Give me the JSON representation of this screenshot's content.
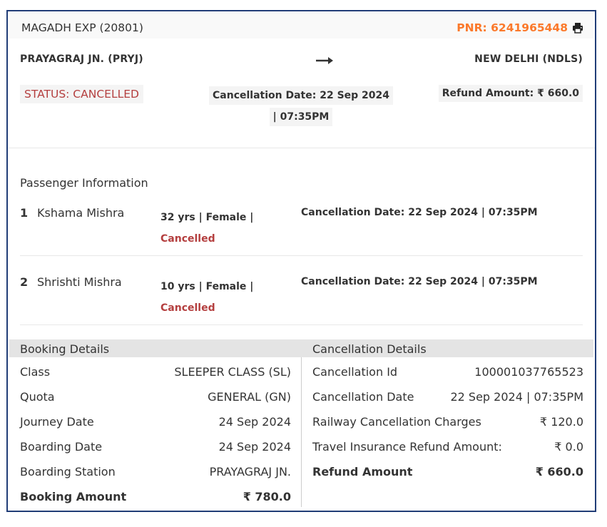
{
  "train": {
    "name": "MAGADH EXP (20801)",
    "pnr": "PNR: 6241965448"
  },
  "route": {
    "from": "PRAYAGRAJ JN. (PRYJ)",
    "to": "NEW DELHI (NDLS)"
  },
  "summary": {
    "status": "STATUS: CANCELLED",
    "cancellation_date": "Cancellation Date: 22 Sep 2024 | 07:35PM",
    "refund_amount": "Refund Amount: ₹ 660.0"
  },
  "passengers": {
    "title": "Passenger Information",
    "list": [
      {
        "num": "1",
        "name": "Kshama Mishra",
        "info": "32 yrs | Female |",
        "status": "Cancelled",
        "cancellation": "Cancellation Date: 22 Sep 2024 | 07:35PM"
      },
      {
        "num": "2",
        "name": "Shrishti Mishra",
        "info": "10 yrs | Female |",
        "status": "Cancelled",
        "cancellation": "Cancellation Date: 22 Sep 2024 | 07:35PM"
      }
    ]
  },
  "booking": {
    "title": "Booking Details",
    "rows": [
      {
        "label": "Class",
        "value": "SLEEPER CLASS (SL)"
      },
      {
        "label": "Quota",
        "value": "GENERAL (GN)"
      },
      {
        "label": "Journey Date",
        "value": "24 Sep 2024"
      },
      {
        "label": "Boarding Date",
        "value": "24 Sep 2024"
      },
      {
        "label": "Boarding Station",
        "value": "PRAYAGRAJ JN."
      },
      {
        "label": "Booking Amount",
        "value": "₹ 780.0"
      }
    ]
  },
  "cancellation": {
    "title": "Cancellation Details",
    "rows": [
      {
        "label": "Cancellation Id",
        "value": "100001037765523"
      },
      {
        "label": "Cancellation Date",
        "value": "22 Sep 2024 | 07:35PM"
      },
      {
        "label": "Railway Cancellation Charges",
        "value": "₹ 120.0"
      },
      {
        "label": "Travel Insurance Refund Amount:",
        "value": "₹ 0.0"
      },
      {
        "label": "Refund Amount",
        "value": "₹ 660.0"
      }
    ]
  },
  "colors": {
    "accent": "#fb792b",
    "border": "#213d77",
    "cancelled": "#b43f3f"
  },
  "icons": {
    "print": "printer-icon",
    "route_arrow": "arrow-right-icon"
  }
}
